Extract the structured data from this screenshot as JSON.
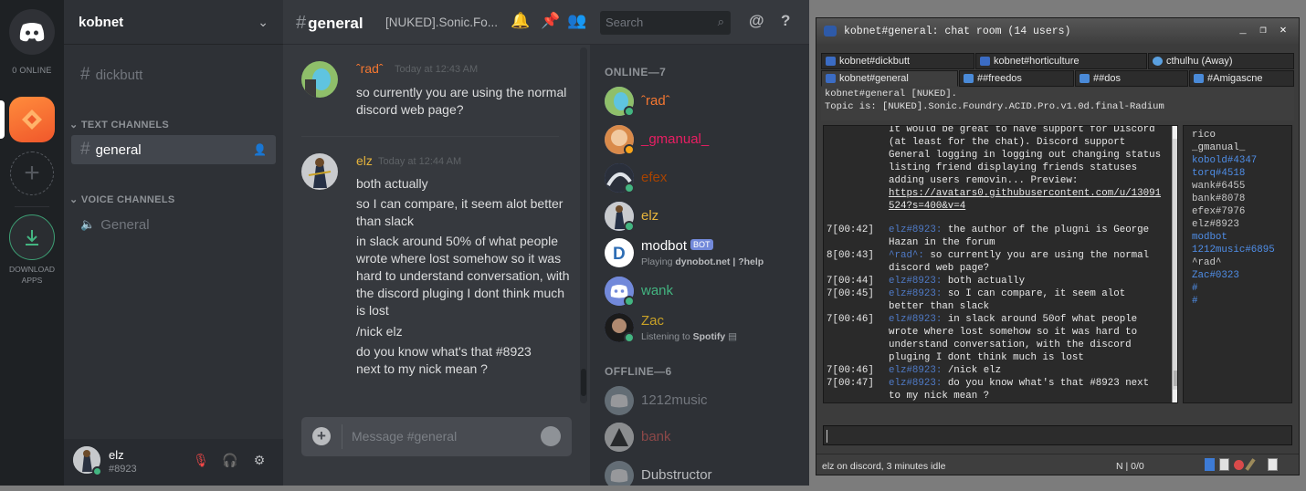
{
  "discord": {
    "guild_sidebar": {
      "online_label": "0 ONLINE",
      "download_label_1": "DOWNLOAD",
      "download_label_2": "APPS"
    },
    "server": {
      "name": "kobnet",
      "top_channel": "dickbutt",
      "text_category": "TEXT CHANNELS",
      "voice_category": "VOICE CHANNELS",
      "active_channel": "general",
      "voice_channel": "General"
    },
    "user": {
      "name": "elz",
      "tag": "#8923"
    },
    "chat": {
      "channel": "general",
      "topic": "[NUKED].Sonic.Fo...",
      "search_placeholder": "Search",
      "input_placeholder": "Message #general",
      "messages": [
        {
          "author": "ˆradˆ",
          "author_color": "#f57731",
          "time": "Today at 12:43 AM",
          "lines": [
            "so currently you are using the normal discord web page?"
          ]
        },
        {
          "author": "elz",
          "author_color": "#e6b43c",
          "time": "Today at 12:44 AM",
          "lines": [
            "both actually",
            "so I can compare, it seem alot better than slack",
            "in slack around 50% of what people wrote where lost somehow so it was hard to understand conversation, with the discord pluging I dont think much is lost",
            "/nick elz",
            "do you know what's that #8923 next to my nick mean ?"
          ]
        }
      ]
    },
    "members": {
      "online_header": "ONLINE—7",
      "offline_header": "OFFLINE—6",
      "online": [
        {
          "name": "ˆradˆ",
          "color": "#f57731",
          "status": "#43b581",
          "activity": "",
          "activity_bold": ""
        },
        {
          "name": "_gmanual_",
          "color": "#e91e63",
          "status": "#faa61a",
          "activity": "",
          "activity_bold": ""
        },
        {
          "name": "efex",
          "color": "#a84300",
          "status": "#43b581",
          "activity": "",
          "activity_bold": ""
        },
        {
          "name": "elz",
          "color": "#e6b43c",
          "status": "#43b581",
          "activity": "",
          "activity_bold": ""
        },
        {
          "name": "modbot",
          "color": "#ffffff",
          "status": "",
          "badge": "BOT",
          "activity": "Playing ",
          "activity_bold": "dynobot.net | ?help"
        },
        {
          "name": "wank",
          "color": "#43b581",
          "status": "#43b581",
          "activity": "",
          "activity_bold": ""
        },
        {
          "name": "Zac",
          "color": "#c9a227",
          "status": "#43b581",
          "activity": "Listening to ",
          "activity_bold": "Spotify"
        }
      ],
      "offline": [
        {
          "name": "1212music",
          "color": "#72767d"
        },
        {
          "name": "bank",
          "color": "#8c4848"
        },
        {
          "name": "Dubstructor",
          "color": "#b9bbbe"
        }
      ]
    }
  },
  "irc": {
    "title": "kobnet#general: chat room (14 users)",
    "tabs_row1": [
      {
        "label": "kobnet#dickbutt",
        "icon_color": "#3b6cc4"
      },
      {
        "label": "kobnet#horticulture",
        "icon_color": "#3b6cc4"
      },
      {
        "label": "cthulhu (Away)",
        "icon_color": "#5aa0e0"
      }
    ],
    "tabs_row2": [
      {
        "label": "kobnet#general",
        "icon_color": "#3b6cc4"
      },
      {
        "label": "##freedos",
        "icon_color": "#4a8ad8"
      },
      {
        "label": "##dos",
        "icon_color": "#4a8ad8"
      },
      {
        "label": "#Amigascne",
        "icon_color": "#4a8ad8"
      }
    ],
    "header_line1": "kobnet#general [NUKED].",
    "header_line2": "Topic is:  [NUKED].Sonic.Foundry.ACID.Pro.v1.0d.final-Radium",
    "log": [
      {
        "time": "",
        "nick": "",
        "text": "It would be great to have support for Discord (at least for the chat). Discord support General logging in logging out changing status listing friend displaying friends statuses adding users removin... Preview:",
        "url": "https://avatars0.githubusercontent.com/u/13091524?s=400&v=4"
      },
      {
        "time": "7[00:42]",
        "nick": "elz#8923:",
        "text": "the author of the plugni is George Hazan in the forum"
      },
      {
        "time": "8[00:43]",
        "nick": "^rad^:",
        "text": "so currently you are using the normal discord web page?"
      },
      {
        "time": "7[00:44]",
        "nick": "elz#8923:",
        "text": "both actually"
      },
      {
        "time": "7[00:45]",
        "nick": "elz#8923:",
        "text": "so I can compare, it seem alot better than slack"
      },
      {
        "time": "7[00:46]",
        "nick": "elz#8923:",
        "text": "in slack around 50of what people wrote where lost somehow so it was hard to understand conversation, with the discord pluging I dont think much is lost"
      },
      {
        "time": "7[00:46]",
        "nick": "elz#8923:",
        "text": "/nick elz"
      },
      {
        "time": "7[00:47]",
        "nick": "elz#8923:",
        "text": "do you know what's that #8923 next to my nick mean ?"
      }
    ],
    "nicklist": [
      {
        "name": "rico",
        "color": "#d8d8d8"
      },
      {
        "name": "_gmanual_",
        "color": "#d8d8d8"
      },
      {
        "name": "kobold#4347",
        "color": "#4f8ee8"
      },
      {
        "name": "torq#4518",
        "color": "#4f8ee8"
      },
      {
        "name": "wank#6455",
        "color": "#c8c8c8"
      },
      {
        "name": "bank#8078",
        "color": "#c8c8c8"
      },
      {
        "name": "efex#7976",
        "color": "#c8c8c8"
      },
      {
        "name": "elz#8923",
        "color": "#c8c8c8"
      },
      {
        "name": "modbot",
        "color": "#4f8ee8"
      },
      {
        "name": "1212music#6895",
        "color": "#4f8ee8"
      },
      {
        "name": "^rad^",
        "color": "#c8c8c8"
      },
      {
        "name": "Zac#0323",
        "color": "#4f8ee8"
      },
      {
        "name": "#",
        "color": "#4f8ee8"
      },
      {
        "name": "#",
        "color": "#4f8ee8"
      }
    ],
    "status_left": "elz on discord, 3 minutes idle",
    "status_mid": "N | 0/0"
  }
}
